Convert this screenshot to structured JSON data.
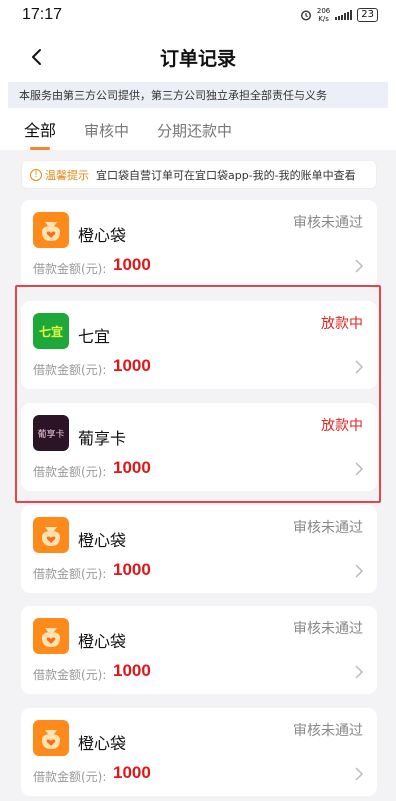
{
  "status_bar": {
    "time": "17:17",
    "speed_value": "206",
    "speed_unit": "K/s",
    "battery": "23"
  },
  "header": {
    "title": "订单记录"
  },
  "notice": "本服务由第三方公司提供，第三方公司独立承担全部责任与义务",
  "tabs": [
    {
      "label": "全部",
      "active": true
    },
    {
      "label": "审核中",
      "active": false
    },
    {
      "label": "分期还款中",
      "active": false
    }
  ],
  "tip": {
    "icon": "info-icon",
    "title": "温馨提示",
    "text": "宜口袋自营订单可在宜口袋app-我的-我的账单中查看"
  },
  "amount_label": "借款金额(元):",
  "orders": [
    {
      "name": "橙心袋",
      "status": "审核未通过",
      "amount": "1000",
      "logo": "orange-bag-logo"
    },
    {
      "name": "七宜",
      "status": "放款中",
      "amount": "1000",
      "logo": "qiyi-logo",
      "logo_text": "七宜"
    },
    {
      "name": "葡享卡",
      "status": "放款中",
      "amount": "1000",
      "logo": "puxiangka-logo",
      "logo_text": "葡享卡"
    },
    {
      "name": "橙心袋",
      "status": "审核未通过",
      "amount": "1000",
      "logo": "orange-bag-logo"
    },
    {
      "name": "橙心袋",
      "status": "审核未通过",
      "amount": "1000",
      "logo": "orange-bag-logo"
    },
    {
      "name": "橙心袋",
      "status": "审核未通过",
      "amount": "1000",
      "logo": "orange-bag-logo"
    }
  ],
  "colors": {
    "accent": "#ff7f2a",
    "lending": "#e0271f",
    "amount": "#e0171a",
    "highlight": "#e8434a"
  }
}
